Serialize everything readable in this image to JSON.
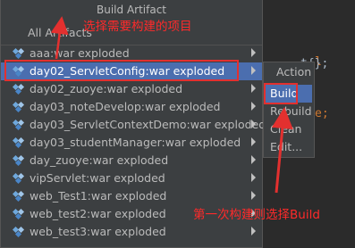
{
  "popup": {
    "title": "Build Artifact",
    "all_artifacts": "All Artifacts",
    "items": [
      {
        "label": "aaa:war exploded"
      },
      {
        "label": "day02_ServletConfig:war exploded"
      },
      {
        "label": "day02_zuoye:war exploded"
      },
      {
        "label": "day03_noteDevelop:war exploded"
      },
      {
        "label": "day03_ServletContextDemo:war exploded"
      },
      {
        "label": "day03_studentManager:war exploded"
      },
      {
        "label": "day_zuoye:war exploded"
      },
      {
        "label": "vipServlet:war exploded"
      },
      {
        "label": "web_Test1:war exploded"
      },
      {
        "label": "web_test2:war exploded"
      },
      {
        "label": "web_test3:war exploded"
      }
    ]
  },
  "submenu": {
    "title": "Action",
    "items": [
      {
        "label": "Build"
      },
      {
        "label": "Rebuild"
      },
      {
        "label": "Clean"
      },
      {
        "label": "Edit..."
      }
    ]
  },
  "editor": {
    "line1": "l",
    "line1_tail": "t{};",
    "line2": "e;"
  },
  "annotations": {
    "top": "选择需要构建的项目",
    "bottom": "第一次构建则选择Build"
  },
  "colors": {
    "selection": "#4b6eaf",
    "annotation_red": "#e3302f"
  }
}
